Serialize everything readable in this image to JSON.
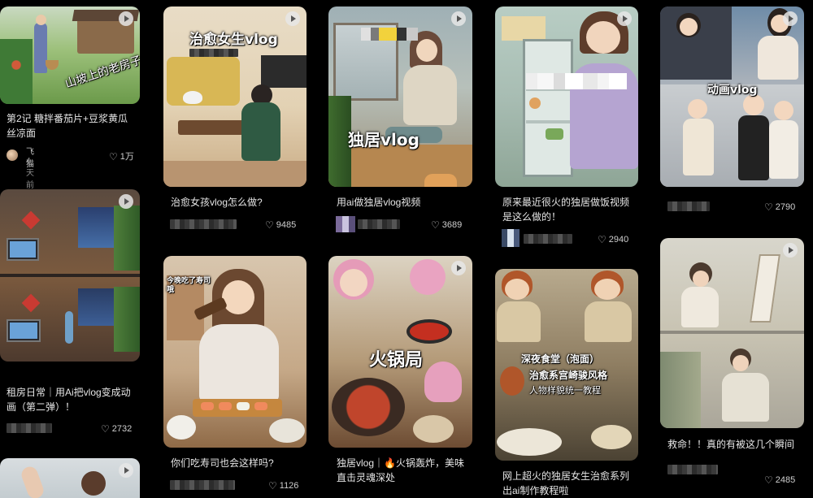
{
  "cards": {
    "c1": {
      "title": "第2记 糖拌番茄片+豆浆黄瓜丝凉面",
      "author": "飞猫",
      "time": "4天前",
      "likes": "1万",
      "overlay": "山坡上的老房子"
    },
    "c2": {
      "title": "租房日常｜用Ai把vlog变成动画（第二弹）！",
      "likes": "2732"
    },
    "c4": {
      "title": "治愈女孩vlog怎么做?",
      "likes": "9485",
      "overlay": "治愈女生vlog"
    },
    "c5": {
      "title": "你们吃寿司也会这样吗?",
      "likes": "1126",
      "overlay": "今晚吃了寿司哦"
    },
    "c6": {
      "title": "用ai做独居vlog视频",
      "likes": "3689",
      "overlay": "独居vlog"
    },
    "c7": {
      "title": "独居vlog｜🔥火锅轰炸，美味直击灵魂深处",
      "likes": "",
      "overlay": "火锅局"
    },
    "c8": {
      "title": "原来最近很火的独居做饭视频是这么做的！",
      "likes": "2940"
    },
    "c9": {
      "title": "网上超火的独居女生治愈系列出ai制作教程啦",
      "likes": "",
      "overlay1": "深夜食堂（泡面）",
      "overlay2": "治愈系宫崎骏风格",
      "overlay3": "人物样貌统一教程"
    },
    "c10": {
      "title": "",
      "likes": "2790",
      "overlay": "动画vlog"
    },
    "c11": {
      "title": "救命！！真的有被这几个瞬间",
      "likes": "2485"
    }
  }
}
